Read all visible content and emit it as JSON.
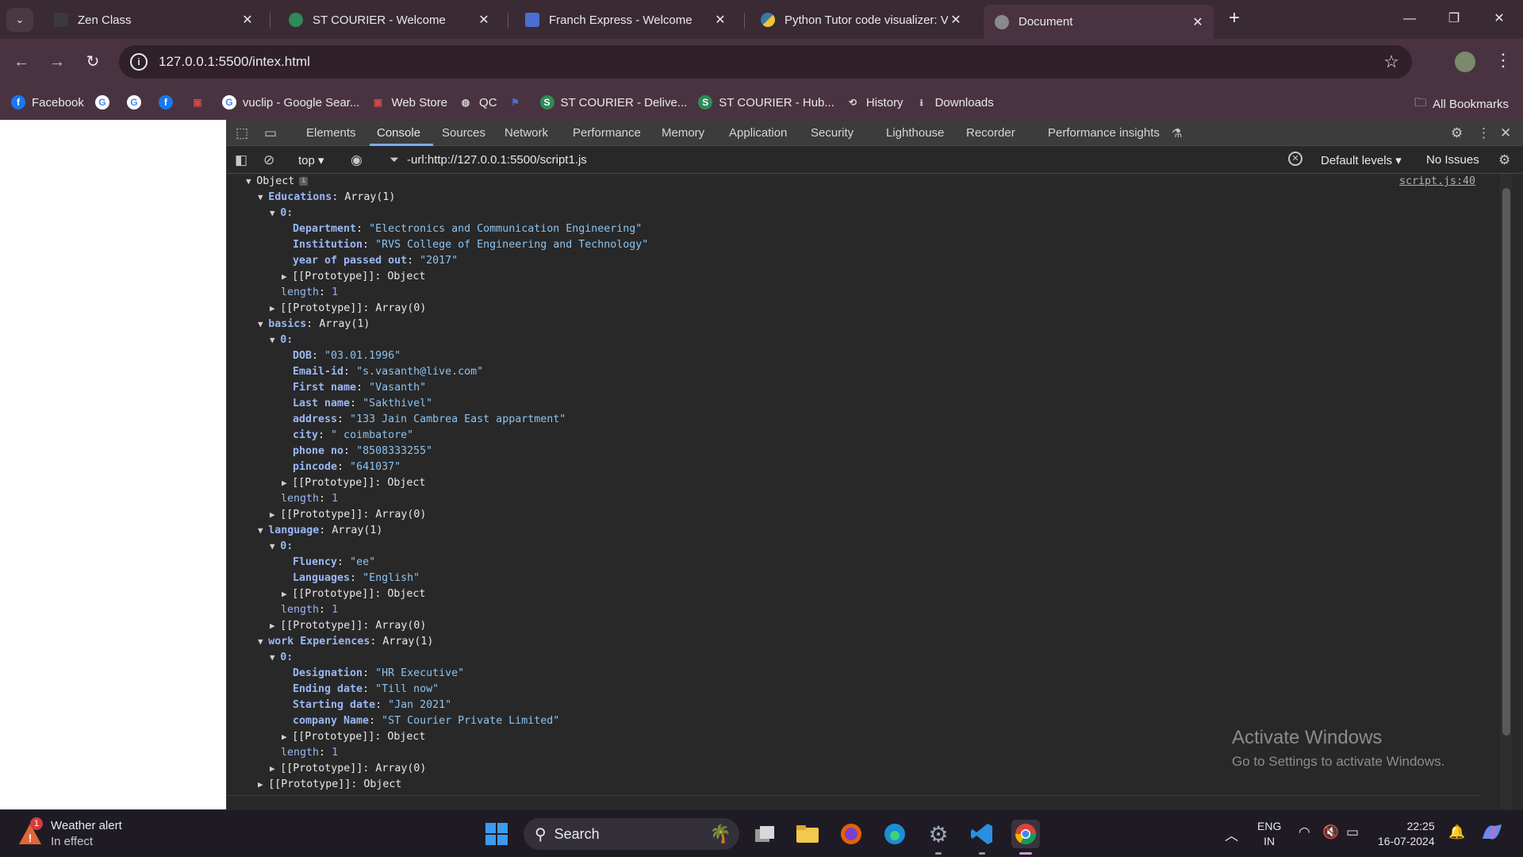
{
  "browser": {
    "tabs": [
      {
        "title": "Zen Class",
        "favicon_color": "#3a3a3a"
      },
      {
        "title": "ST COURIER - Welcome",
        "favicon_color": "#2e8b57"
      },
      {
        "title": "Franch Express - Welcome",
        "favicon_color": "#4a6fd1"
      },
      {
        "title": "Python Tutor code visualizer: Vi",
        "favicon_color": "#f0c43a"
      },
      {
        "title": "Document",
        "favicon_color": "#8a8a8a"
      }
    ],
    "active_tab": 4,
    "address": "127.0.0.1:5500/intex.html",
    "bookmarks": [
      {
        "label": "Facebook",
        "icon": "facebook-icon",
        "color": "#1877f2"
      },
      {
        "label": "",
        "icon": "google-icon",
        "color": "#ffffff"
      },
      {
        "label": "",
        "icon": "google-icon",
        "color": "#ffffff"
      },
      {
        "label": "",
        "icon": "facebook-icon",
        "color": "#1877f2"
      },
      {
        "label": "",
        "icon": "store-icon",
        "color": "#d04a4a"
      },
      {
        "label": "vuclip - Google Sear...",
        "icon": "google-icon",
        "color": "#ffffff"
      },
      {
        "label": "Web Store",
        "icon": "store-icon",
        "color": "#d04a4a"
      },
      {
        "label": "QC",
        "icon": "globe-icon",
        "color": "#d0d0d0"
      },
      {
        "label": "",
        "icon": "flag-icon",
        "color": "#4a6fd1"
      },
      {
        "label": "ST COURIER - Delive...",
        "icon": "stcourier-icon",
        "color": "#2e8b57"
      },
      {
        "label": "ST COURIER - Hub...",
        "icon": "stcourier-icon",
        "color": "#2e8b57"
      },
      {
        "label": "History",
        "icon": "history-icon",
        "color": "#d0d0d0"
      },
      {
        "label": "Downloads",
        "icon": "download-icon",
        "color": "#d0d0d0"
      }
    ],
    "all_bookmarks": "All Bookmarks"
  },
  "devtools": {
    "tabs": [
      "Elements",
      "Console",
      "Sources",
      "Network",
      "Performance",
      "Memory",
      "Application",
      "Security",
      "Lighthouse",
      "Recorder",
      "Performance insights"
    ],
    "active_tab": "Console",
    "context": "top",
    "filter": "-url:http://127.0.0.1:5500/script1.js",
    "levels": "Default levels",
    "issues": "No Issues",
    "source_link": "script.js:40"
  },
  "console_tree": {
    "root": "Object",
    "educations": {
      "key": "Educations",
      "type": "Array(1)",
      "index": "0:",
      "department": "\"Electronics and Communication Engineering\"",
      "institution": "\"RVS College of Engineering and Technology\"",
      "year": "\"2017\""
    },
    "basics": {
      "key": "basics",
      "type": "Array(1)",
      "index": "0:",
      "dob": "\"03.01.1996\"",
      "email": "\"s.vasanth@live.com\"",
      "first_name": "\"Vasanth\"",
      "last_name": "\"Sakthivel\"",
      "address": "\"133 Jain Cambrea East appartment\"",
      "city": "\" coimbatore\"",
      "phone": "\"8508333255\"",
      "pincode": "\"641037\""
    },
    "language": {
      "key": "language",
      "type": "Array(1)",
      "index": "0:",
      "fluency": "\"ee\"",
      "languages": "\"English\""
    },
    "work": {
      "key": "work Experiences",
      "type": "Array(1)",
      "index": "0:",
      "designation": "\"HR Executive\"",
      "ending": "\"Till now\"",
      "starting": "\"Jan 2021\"",
      "company": "\"ST Courier Private Limited\""
    },
    "proto_object": "[[Prototype]]",
    "proto_object_val": "Object",
    "proto_array_val": "Array(0)",
    "length_key": "length",
    "length_val": "1"
  },
  "watermark": {
    "line1": "Activate Windows",
    "line2": "Go to Settings to activate Windows."
  },
  "taskbar": {
    "weather_title": "Weather alert",
    "weather_sub": "In effect",
    "weather_badge": "1",
    "search": "Search",
    "lang1": "ENG",
    "lang2": "IN",
    "time": "22:25",
    "date": "16-07-2024"
  }
}
